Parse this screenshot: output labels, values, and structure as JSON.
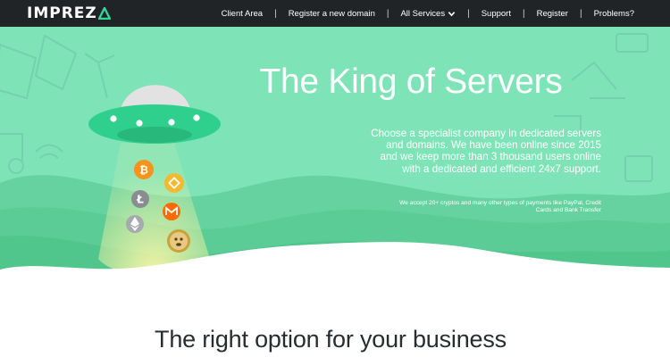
{
  "brand": {
    "name": "IMPREZ",
    "accent_color": "#35d39a"
  },
  "nav": {
    "items": [
      {
        "label": "Client Area"
      },
      {
        "label": "Register a new domain"
      },
      {
        "label": "All Services",
        "icon": "chevron-down-icon"
      },
      {
        "label": "Support"
      },
      {
        "label": "Register"
      },
      {
        "label": "Problems?"
      }
    ],
    "separator": "|"
  },
  "hero": {
    "title": "The King of Servers",
    "description": "Choose a specialist company in dedicated servers and domains. We have been online since 2015 and we keep more than 3 thousand users online with a dedicated and efficient 24x7 support.",
    "payment_note": "We accept 20+ cryptos and many other types of payments like PayPal, Credit Cards and Bank Transfer",
    "background_color": "#7fe3b8",
    "illustration": {
      "icons": [
        "ufo-icon",
        "bitcoin-icon",
        "binance-icon",
        "litecoin-icon",
        "monero-icon",
        "ethereum-icon",
        "dogecoin-icon"
      ]
    }
  },
  "section": {
    "title": "The right option for your business"
  }
}
